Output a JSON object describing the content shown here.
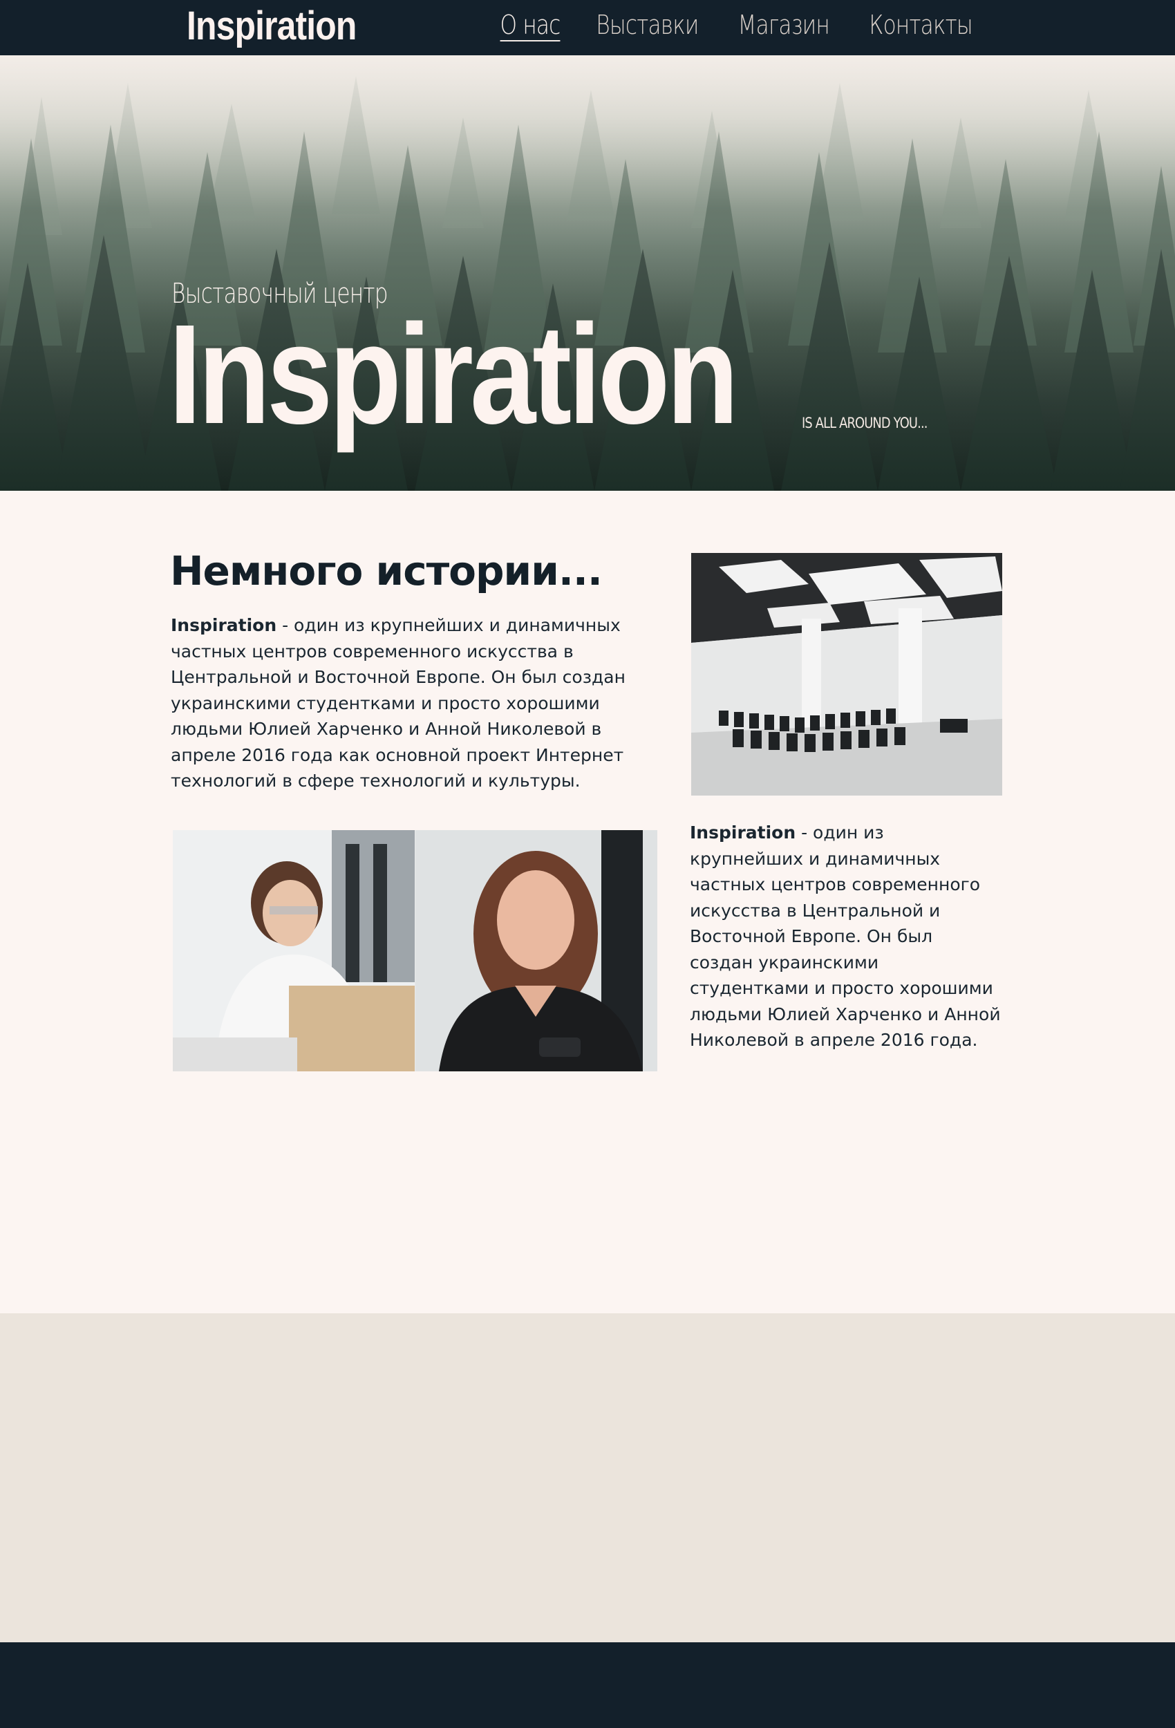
{
  "header": {
    "logo": "Inspiration",
    "nav": [
      {
        "label": "О нас",
        "active": true
      },
      {
        "label": "Выставки",
        "active": false
      },
      {
        "label": "Магазин",
        "active": false
      },
      {
        "label": "Контакты",
        "active": false
      }
    ]
  },
  "hero": {
    "subtitle": "Выставочный центр",
    "title": "Inspiration",
    "tagline": "IS ALL AROUND YOU..."
  },
  "about": {
    "heading": "Немного истории...",
    "paragraph1": {
      "strong": "Inspiration",
      "text": " - один из крупнейших и динамичных частных центров современного искусства в Центральной и Восточной Европе. Он был создан украинскими студентками и просто хорошими людьми Юлией Харченко и Анной Николевой в апреле 2016 года как основной проект Интернет технологий в сфере технологий и культуры."
    },
    "paragraph2": {
      "strong": "Inspiration",
      "text": " - один из крупнейших и динамичных частных центров современного искусства в Центральной и Восточной Европе. Он был создан украинскими студентками и просто хорошими людьми Юлией Харченко и Анной Николевой в апреле 2016 года."
    }
  },
  "colors": {
    "dark": "#13202b",
    "page_bg": "#fcf5f2",
    "band_bg": "#ebe4dc",
    "text": "#142029"
  }
}
